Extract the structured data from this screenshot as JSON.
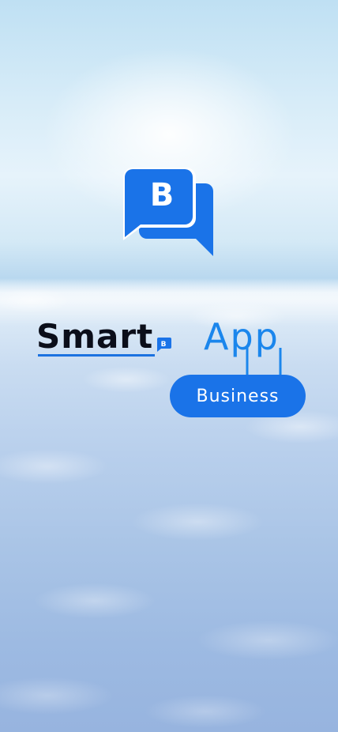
{
  "splash": {
    "brand_word_1": "Smart",
    "brand_word_2": "App",
    "badge_label": "Business",
    "icon_letter": "B",
    "badge_letter": "B"
  },
  "icons": {
    "app_icon": "chat-bubbles-b-icon",
    "inline_badge": "chat-bubble-b-icon"
  },
  "colors": {
    "brand_blue": "#1a73e8",
    "brand_dark": "#0b0e1a",
    "sky_light": "#e6f3fb"
  }
}
